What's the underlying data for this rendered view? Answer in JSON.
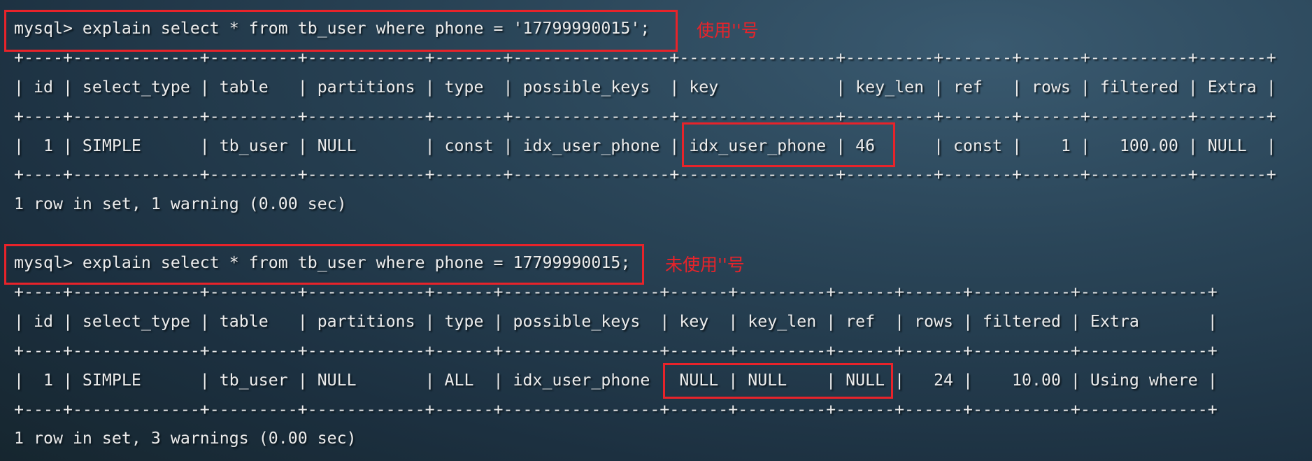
{
  "terminal": {
    "lines": [
      "mysql> explain select * from tb_user where phone = '17799990015';",
      "+----+-------------+---------+------------+-------+----------------+----------------+---------+-------+------+----------+-------+",
      "| id | select_type | table   | partitions | type  | possible_keys  | key            | key_len | ref   | rows | filtered | Extra |",
      "+----+-------------+---------+------------+-------+----------------+----------------+---------+-------+------+----------+-------+",
      "|  1 | SIMPLE      | tb_user | NULL       | const | idx_user_phone | idx_user_phone | 46      | const |    1 |   100.00 | NULL  |",
      "+----+-------------+---------+------------+-------+----------------+----------------+---------+-------+------+----------+-------+",
      "1 row in set, 1 warning (0.00 sec)",
      "",
      "mysql> explain select * from tb_user where phone = 17799990015;",
      "+----+-------------+---------+------------+------+----------------+------+---------+------+------+----------+-------------+",
      "| id | select_type | table   | partitions | type | possible_keys  | key  | key_len | ref  | rows | filtered | Extra       |",
      "+----+-------------+---------+------------+------+----------------+------+---------+------+------+----------+-------------+",
      "|  1 | SIMPLE      | tb_user | NULL       | ALL  | idx_user_phone   NULL | NULL    | NULL |   24 |    10.00 | Using where |",
      "+----+-------------+---------+------------+------+----------------+------+---------+------+------+----------+-------------+",
      "1 row in set, 3 warnings (0.00 sec)"
    ]
  },
  "annotations": {
    "quoted": "使用''号",
    "unquoted": "未使用''号",
    "color": "#e8232a"
  }
}
